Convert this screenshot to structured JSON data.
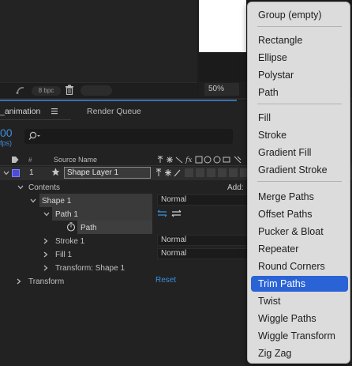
{
  "project_panel": {
    "bpc_label": "8 bpc"
  },
  "composition_panel": {
    "zoom_value": "50%"
  },
  "timeline": {
    "tab_label": "_animation",
    "render_queue_label": "Render Queue",
    "timecode": "00",
    "fps": "fps)",
    "columns": {
      "number": "#",
      "source_name": "Source Name"
    },
    "layer": {
      "number": "1",
      "name": "Shape Layer 1",
      "color": "#4b4ed8"
    },
    "contents_label": "Contents",
    "add_label": "Add:",
    "rows": {
      "shape1": "Shape 1",
      "path1": "Path 1",
      "path": "Path",
      "stroke1": "Stroke 1",
      "fill1": "Fill 1",
      "transform_shape1": "Transform: Shape 1",
      "transform": "Transform"
    },
    "blend_modes": {
      "shape1": "Normal",
      "stroke1": "Normal",
      "fill1": "Normal"
    },
    "reset_label": "Reset"
  },
  "add_menu": {
    "items": [
      "Group (empty)",
      "Rectangle",
      "Ellipse",
      "Polystar",
      "Path",
      "Fill",
      "Stroke",
      "Gradient Fill",
      "Gradient Stroke",
      "Merge Paths",
      "Offset Paths",
      "Pucker & Bloat",
      "Repeater",
      "Round Corners",
      "Trim Paths",
      "Twist",
      "Wiggle Paths",
      "Wiggle Transform",
      "Zig Zag"
    ],
    "selected_item": "Trim Paths",
    "highlight_color": "#2a63d6"
  }
}
